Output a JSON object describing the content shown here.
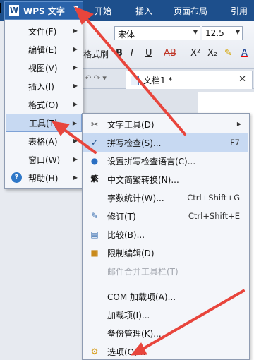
{
  "app": {
    "button_label": "WPS 文字",
    "logo_letter": "W",
    "ribbon_tabs": [
      "开始",
      "插入",
      "页面布局",
      "引用"
    ]
  },
  "toolbar": {
    "font_name": "宋体",
    "font_size": "12.5",
    "format_painter_label": "格式刷",
    "buttons": [
      "B",
      "I",
      "U",
      "AB",
      "X²",
      "X₂"
    ]
  },
  "document": {
    "tab_title": "文档1 *"
  },
  "main_menu": {
    "items": [
      {
        "label": "文件(F)",
        "has_submenu": true
      },
      {
        "label": "编辑(E)",
        "has_submenu": true
      },
      {
        "label": "视图(V)",
        "has_submenu": true
      },
      {
        "label": "插入(I)",
        "has_submenu": true
      },
      {
        "label": "格式(O)",
        "has_submenu": true
      },
      {
        "label": "工具(T)",
        "has_submenu": true,
        "active": true
      },
      {
        "label": "表格(A)",
        "has_submenu": true
      },
      {
        "label": "窗口(W)",
        "has_submenu": true
      },
      {
        "label": "帮助(H)",
        "has_submenu": true,
        "icon": "help-icon"
      }
    ]
  },
  "tools_submenu": {
    "items": [
      {
        "label": "文字工具(D)",
        "has_submenu": true,
        "icon": "text-tools-icon"
      },
      {
        "label": "拼写检查(S)...",
        "shortcut": "F7",
        "icon": "spellcheck-icon",
        "hover": true
      },
      {
        "label": "设置拼写检查语言(C)...",
        "icon": "language-icon"
      },
      {
        "label": "中文简繁转换(N)...",
        "icon": "chinese-convert-icon"
      },
      {
        "label": "字数统计(W)...",
        "shortcut": "Ctrl+Shift+G"
      },
      {
        "label": "修订(T)",
        "shortcut": "Ctrl+Shift+E",
        "icon": "track-changes-icon"
      },
      {
        "label": "比较(B)...",
        "icon": "compare-icon"
      },
      {
        "label": "限制编辑(D)",
        "icon": "restrict-edit-icon"
      },
      {
        "label": "邮件合并工具栏(T)",
        "disabled": true
      },
      {
        "label": "COM 加载项(A)..."
      },
      {
        "label": "加载项(I)..."
      },
      {
        "label": "备份管理(K)..."
      },
      {
        "label": "选项(O)...",
        "icon": "options-gear-icon"
      }
    ]
  },
  "colors": {
    "title_bar": "#1d4f8c",
    "menu_background": "#f4f6fa",
    "highlight": "#c7d9f2",
    "annotation_arrow": "#e8453c"
  }
}
